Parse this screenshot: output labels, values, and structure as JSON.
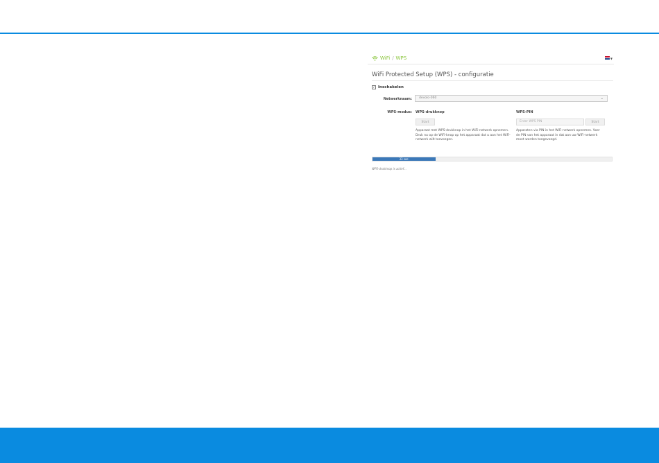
{
  "breadcrumb": {
    "items": [
      "WiFi",
      "WPS"
    ],
    "separator": "/",
    "icon": "wifi-icon"
  },
  "language_flag": "dutch-flag-icon",
  "page": {
    "title": "WiFi Protected Setup (WPS) - configuratie"
  },
  "enable": {
    "label": "Inschakelen",
    "checked": true
  },
  "network": {
    "label": "Netwerknaam:",
    "value": "devolo-060"
  },
  "wps_mode": {
    "label": "WPS-modus:",
    "pushbutton": {
      "title": "WPS-drukknop",
      "button_label": "Start",
      "description": "Apparaat met WPS-drukknop in het WiFi-netwerk opnemen. Druk nu op de WiFi-knop op het apparaat dat u aan het WiFi-netwerk wilt toevoegen."
    },
    "pin": {
      "title": "WPS-PIN",
      "placeholder": "Enter WPS PIN",
      "button_label": "Start",
      "description": "Apparaten via PIN in het WiFi-netwerk opnemen. Voer de PIN van het apparaat in dat aan uw WiFi-netwerk moet worden toegevoegd."
    }
  },
  "progress": {
    "label": "33 sec.",
    "fraction": 0.265
  },
  "status": {
    "text": "WPS-drukknop is actief..."
  },
  "colors": {
    "brand_blue": "#0a8be0",
    "accent_green": "#8cc63f",
    "progress_blue": "#3b78b8"
  }
}
